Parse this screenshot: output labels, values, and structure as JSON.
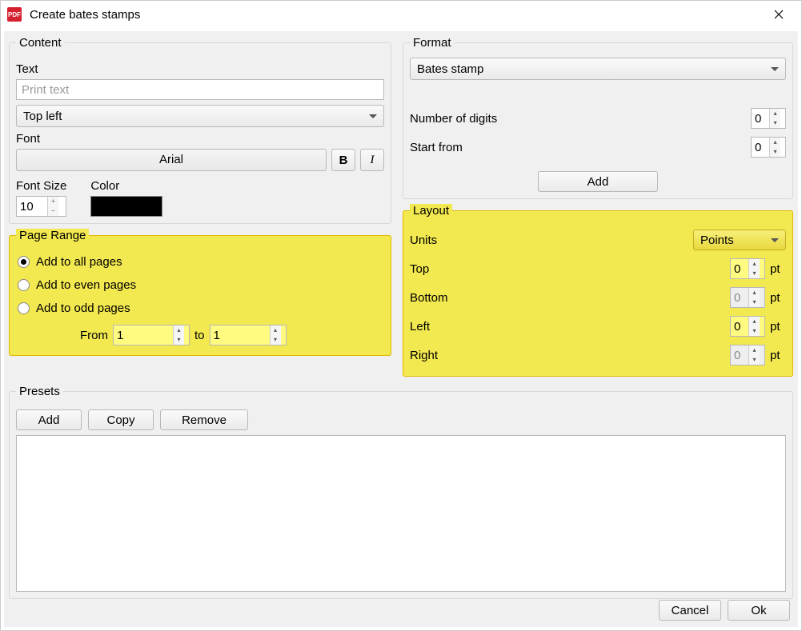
{
  "window": {
    "title": "Create bates stamps",
    "icon_text": "PDF"
  },
  "content": {
    "legend": "Content",
    "text_label": "Text",
    "text_placeholder": "Print text",
    "text_value": "",
    "position_value": "Top left",
    "font_label": "Font",
    "font_value": "Arial",
    "bold_label": "B",
    "italic_label": "I",
    "font_size_label": "Font Size",
    "font_size_value": "10",
    "color_label": "Color",
    "color_value": "#000000"
  },
  "page_range": {
    "legend": "Page Range",
    "options": {
      "all": "Add to all pages",
      "even": "Add to even pages",
      "odd": "Add to odd pages"
    },
    "selected": "all",
    "from_label": "From",
    "from_value": "1",
    "to_label": "to",
    "to_value": "1"
  },
  "format": {
    "legend": "Format",
    "type_value": "Bates stamp",
    "digits_label": "Number of digits",
    "digits_value": "0",
    "start_label": "Start from",
    "start_value": "0",
    "add_label": "Add"
  },
  "layout": {
    "legend": "Layout",
    "units_label": "Units",
    "units_value": "Points",
    "unit_suffix": "pt",
    "top_label": "Top",
    "top_value": "0",
    "bottom_label": "Bottom",
    "bottom_value": "0",
    "left_label": "Left",
    "left_value": "0",
    "right_label": "Right",
    "right_value": "0"
  },
  "presets": {
    "legend": "Presets",
    "add_label": "Add",
    "copy_label": "Copy",
    "remove_label": "Remove"
  },
  "footer": {
    "cancel_label": "Cancel",
    "ok_label": "Ok"
  }
}
